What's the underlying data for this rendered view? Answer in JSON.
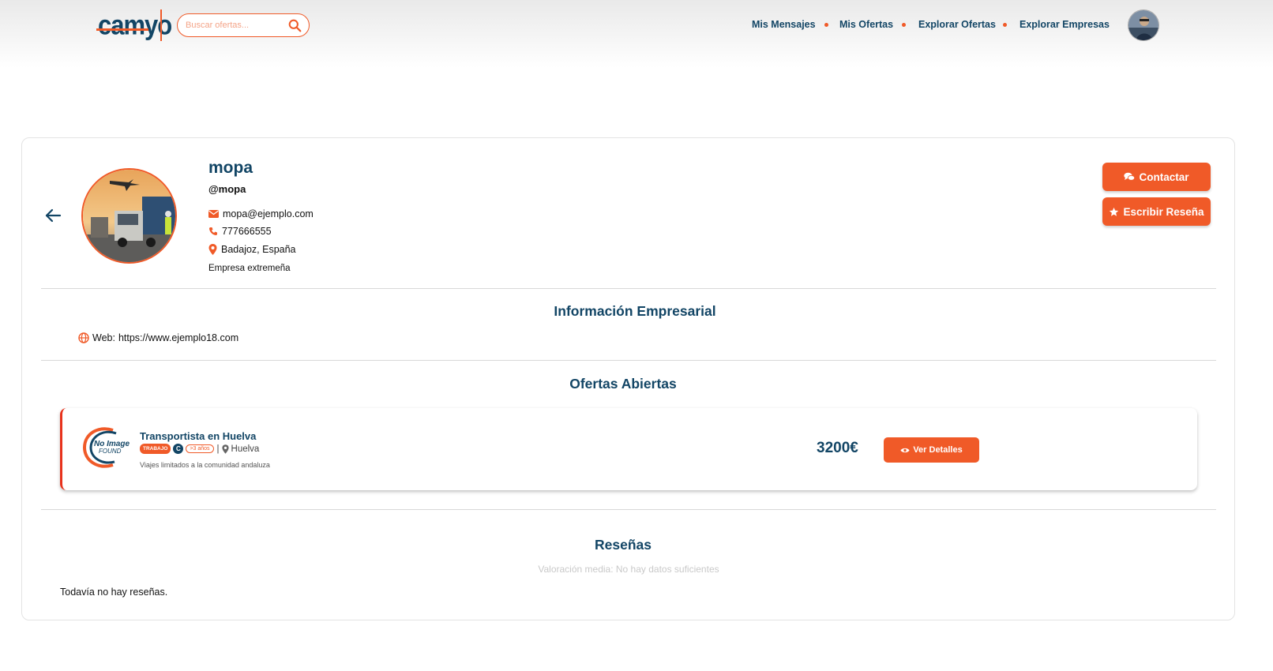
{
  "header": {
    "logo_text": "camyo",
    "search_placeholder": "Buscar ofertas...",
    "nav": [
      "Mis Mensajes",
      "Mis Ofertas",
      "Explorar Ofertas",
      "Explorar Empresas"
    ]
  },
  "profile": {
    "name": "mopa",
    "handle": "@mopa",
    "email": "mopa@ejemplo.com",
    "phone": "777666555",
    "location": "Badajoz, España",
    "description": "Empresa extremeña"
  },
  "actions": {
    "contact": "Contactar",
    "review": "Escribir Reseña"
  },
  "business_info": {
    "title": "Información Empresarial",
    "web_label": "Web:",
    "web_url": "https://www.ejemplo18.com"
  },
  "offers": {
    "title": "Ofertas Abiertas",
    "items": [
      {
        "logo_line1": "No Image",
        "logo_line2": "FOUND",
        "title": "Transportista en Huelva",
        "type_badge": "TRABAJO",
        "license_badge": "C",
        "experience_badge": ">3 años",
        "separator": "|",
        "location": "Huelva",
        "description": "Viajes limitados a la comunidad andaluza",
        "price": "3200€",
        "details_button": "Ver Detalles"
      }
    ]
  },
  "reviews": {
    "title": "Reseñas",
    "rating": "Valoración media: No hay datos suficientes",
    "empty": "Todavía no hay reseñas."
  },
  "colors": {
    "accent": "#f05a28",
    "primary": "#124565"
  }
}
